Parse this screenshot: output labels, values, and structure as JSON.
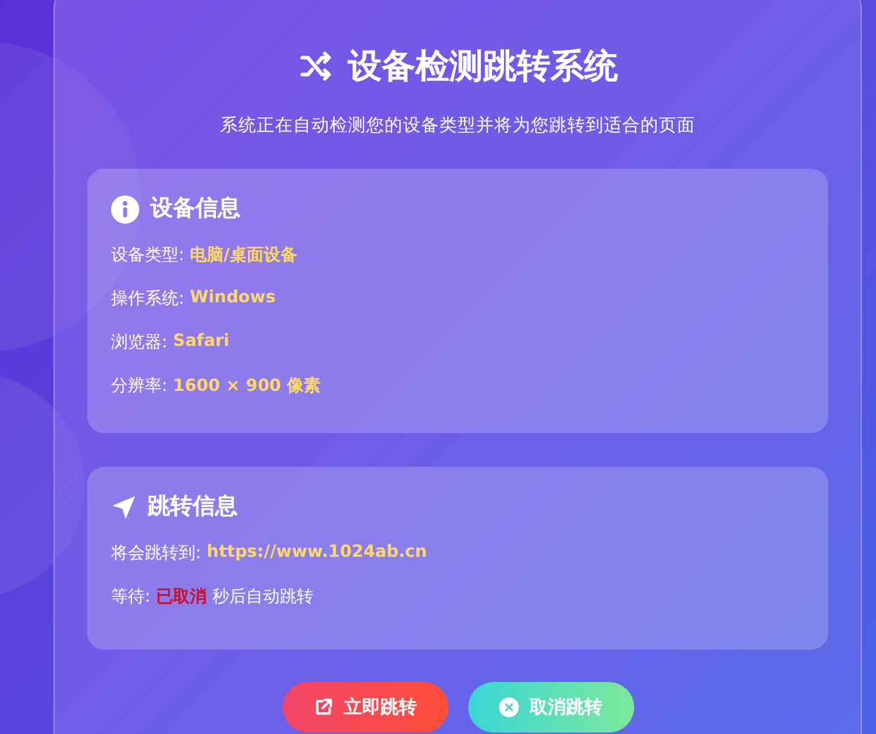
{
  "header": {
    "title": "设备检测跳转系统",
    "subtitle": "系统正在自动检测您的设备类型并将为您跳转到适合的页面"
  },
  "device_info": {
    "title": "设备信息",
    "items": [
      {
        "label": "设备类型:",
        "value": "电脑/桌面设备"
      },
      {
        "label": "操作系统:",
        "value": "Windows"
      },
      {
        "label": "浏览器:",
        "value": "Safari"
      },
      {
        "label": "分辨率:",
        "value": "1600 × 900 像素"
      }
    ]
  },
  "redirect_info": {
    "title": "跳转信息",
    "target_label": "将会跳转到:",
    "target_url": "https://www.1024ab.cn",
    "wait_label": "等待:",
    "wait_status": "已取消",
    "wait_suffix": "秒后自动跳转"
  },
  "buttons": [
    {
      "kind": "go",
      "label": "立即跳转"
    },
    {
      "kind": "cancel",
      "label": "取消跳转"
    }
  ]
}
